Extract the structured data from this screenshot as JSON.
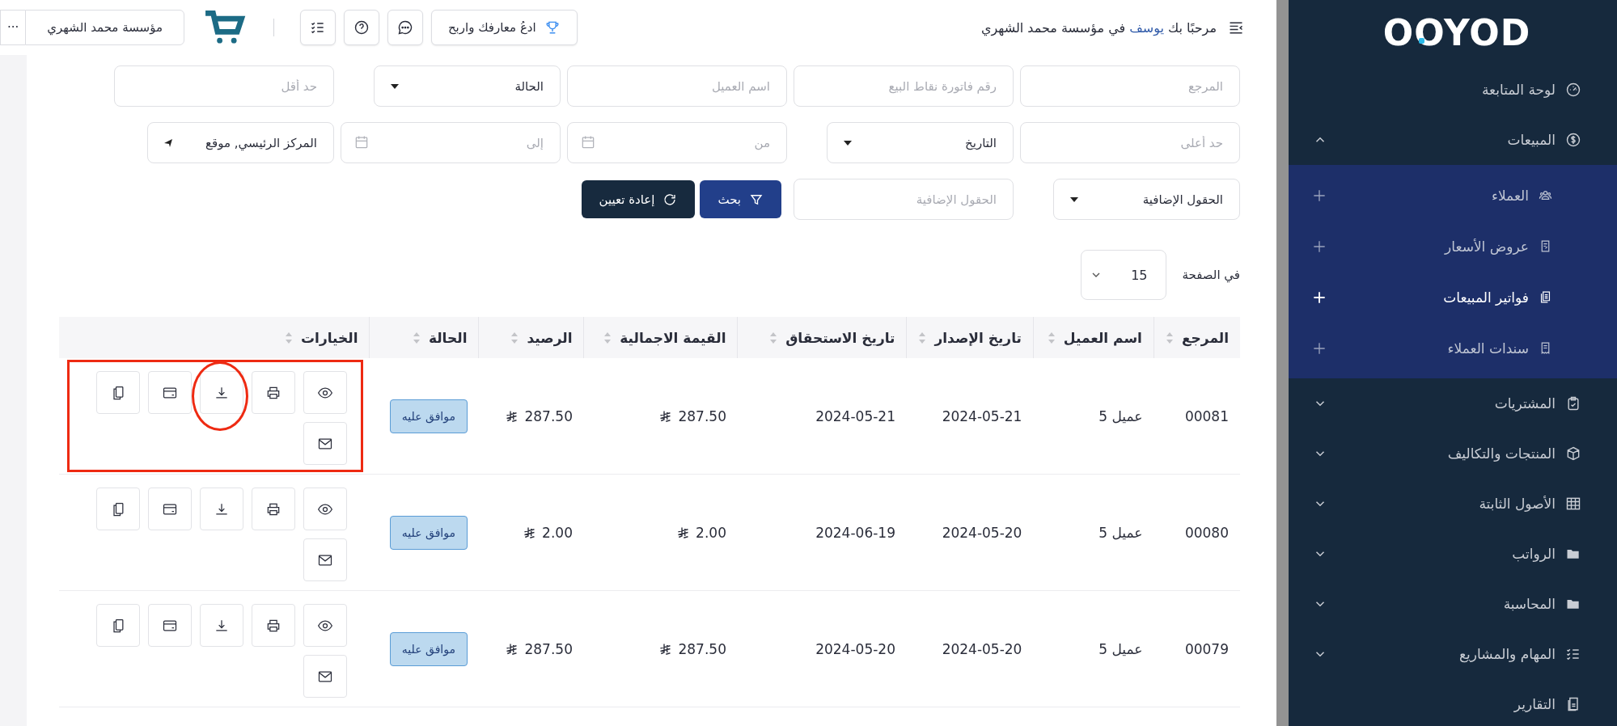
{
  "sidebar": {
    "logo": "OOYOD",
    "items": [
      {
        "label": "لوحة المتابعة"
      },
      {
        "label": "المبيعات",
        "expanded": true,
        "children": [
          {
            "label": "العملاء",
            "selected": false
          },
          {
            "label": "عروض الأسعار",
            "selected": false
          },
          {
            "label": "فواتير المبيعات",
            "selected": true
          },
          {
            "label": "سندات العملاء",
            "selected": false
          }
        ]
      },
      {
        "label": "المشتريات",
        "expanded": false
      },
      {
        "label": "المنتجات والتكاليف",
        "expanded": false
      },
      {
        "label": "الأصول الثابتة",
        "expanded": false
      },
      {
        "label": "الرواتب",
        "expanded": false
      },
      {
        "label": "المحاسبة",
        "expanded": false
      },
      {
        "label": "المهام والمشاريع",
        "expanded": false
      },
      {
        "label": "التقارير"
      }
    ]
  },
  "header": {
    "greeting": {
      "prefix": "مرحبًا بك",
      "name": "يوسف",
      "suffix": "في مؤسسة محمد الشهري"
    },
    "invite_button": "ادعُ معارفك واربح",
    "company": "مؤسسة محمد الشهري",
    "more": "···"
  },
  "filters": [
    [
      {
        "kind": "input",
        "placeholder": "المرجع"
      },
      {
        "kind": "input",
        "placeholder": "رقم فاتورة نقاط البيع"
      },
      {
        "kind": "input",
        "placeholder": "اسم العميل"
      },
      {
        "kind": "select",
        "value": "الحالة"
      },
      {
        "kind": "input",
        "placeholder": "حد أقل"
      }
    ],
    [
      {
        "kind": "input",
        "placeholder": "حد أعلى"
      },
      {
        "kind": "select",
        "value": "التاريخ"
      },
      {
        "kind": "date",
        "placeholder": "من"
      },
      {
        "kind": "date",
        "placeholder": "إلى"
      },
      {
        "kind": "location",
        "value": "المركز الرئيسي, موقع"
      }
    ],
    [
      {
        "kind": "select",
        "value": "الحقول الإضافية"
      },
      {
        "kind": "input",
        "placeholder": "الحقول الإضافية"
      }
    ]
  ],
  "search_button": "بحث",
  "reset_button": "إعادة تعيين",
  "per_page": {
    "label": "في الصفحة",
    "value": "15"
  },
  "table": {
    "columns": [
      "المرجع",
      "اسم العميل",
      "تاريخ الإصدار",
      "تاريخ الاستحقاق",
      "القيمة الاجمالية",
      "الرصيد",
      "الحالة",
      "الخيارات"
    ],
    "rows": [
      {
        "reference": "00081",
        "customer": "عميل 5",
        "issue_date": "2024-05-21",
        "due_date": "2024-05-21",
        "total": "287.50",
        "balance": "287.50",
        "status": "موافق عليه",
        "annotated": true
      },
      {
        "reference": "00080",
        "customer": "عميل 5",
        "issue_date": "2024-05-20",
        "due_date": "2024-06-19",
        "total": "2.00",
        "balance": "2.00",
        "status": "موافق عليه",
        "annotated": false
      },
      {
        "reference": "00079",
        "customer": "عميل 5",
        "issue_date": "2024-05-20",
        "due_date": "2024-05-20",
        "total": "287.50",
        "balance": "287.50",
        "status": "موافق عليه",
        "annotated": false
      }
    ]
  }
}
